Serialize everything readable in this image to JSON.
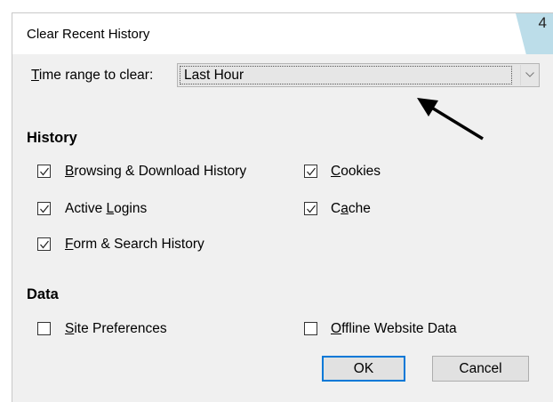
{
  "dialog": {
    "title": "Clear Recent History",
    "badge": "4"
  },
  "time_range": {
    "label_prefix": "",
    "label_mnemonic": "T",
    "label_rest": "ime range to clear:",
    "selected": "Last Hour"
  },
  "history": {
    "heading": "History",
    "items": [
      {
        "mnemonic": "B",
        "rest": "rowsing & Download History",
        "checked": true
      },
      {
        "mnemonic": "C",
        "rest": "ookies",
        "checked": true
      },
      {
        "prefix": "Active ",
        "mnemonic": "L",
        "rest": "ogins",
        "checked": true
      },
      {
        "prefix": "C",
        "mnemonic": "a",
        "rest": "che",
        "checked": true
      },
      {
        "mnemonic": "F",
        "rest": "orm & Search History",
        "checked": true
      }
    ]
  },
  "data": {
    "heading": "Data",
    "items": [
      {
        "mnemonic": "S",
        "rest": "ite Preferences",
        "checked": false
      },
      {
        "mnemonic": "O",
        "rest": "ffline Website Data",
        "checked": false
      }
    ]
  },
  "buttons": {
    "ok": "OK",
    "cancel": "Cancel"
  },
  "colors": {
    "dialog_bg": "#f0f0f0",
    "badge_bg": "#bcdde9",
    "focus_border": "#0078d7"
  }
}
